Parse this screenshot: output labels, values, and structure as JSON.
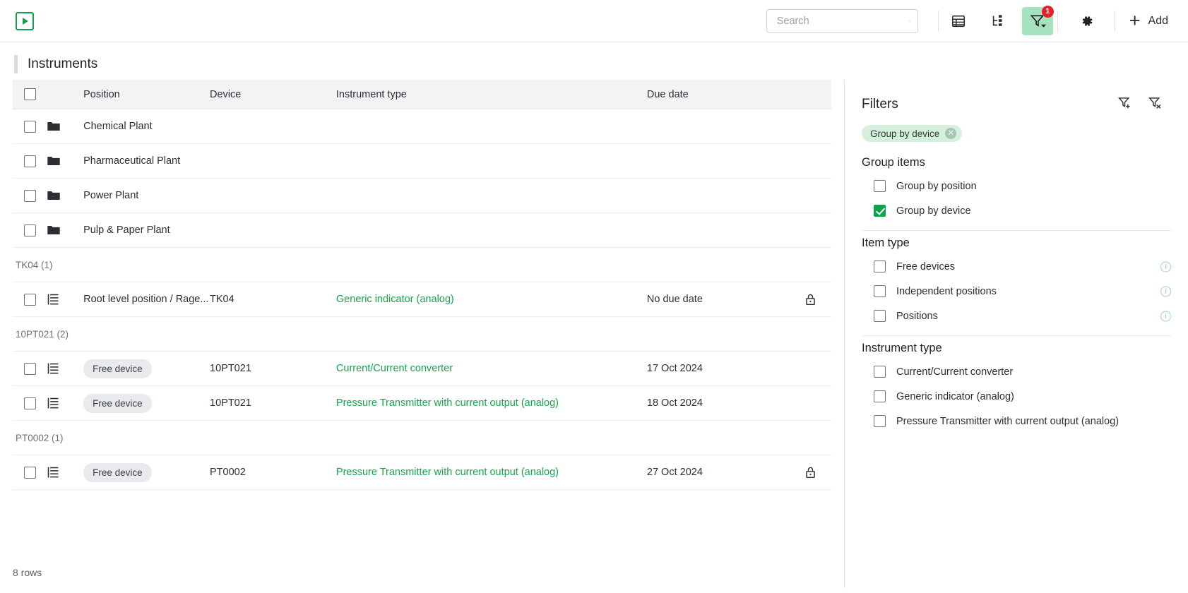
{
  "topbar": {
    "logo_icon": "play-square-logo",
    "search": {
      "value": "",
      "placeholder": "Search"
    },
    "search_icon": "search-icon",
    "tools": [
      {
        "name": "table-view-icon",
        "label": "",
        "active": false
      },
      {
        "name": "tree-view-icon",
        "label": "",
        "active": false
      },
      {
        "name": "filter-icon",
        "label": "",
        "active": true,
        "badge": "1"
      },
      {
        "name": "gear-icon",
        "label": "",
        "active": false
      }
    ],
    "add_label": "Add"
  },
  "page": {
    "title": "Instruments",
    "footer_rows": "8 rows"
  },
  "table": {
    "columns": [
      "Position",
      "Device",
      "Instrument type",
      "Due date"
    ],
    "rows": [
      {
        "kind": "folder",
        "icon": "folder-icon",
        "position": "Chemical Plant",
        "device": "",
        "type": "",
        "due": "",
        "locked": false,
        "badge": ""
      },
      {
        "kind": "folder",
        "icon": "folder-icon",
        "position": "Pharmaceutical Plant",
        "device": "",
        "type": "",
        "due": "",
        "locked": false,
        "badge": ""
      },
      {
        "kind": "folder",
        "icon": "folder-icon",
        "position": "Power Plant",
        "device": "",
        "type": "",
        "due": "",
        "locked": false,
        "badge": ""
      },
      {
        "kind": "folder",
        "icon": "folder-icon",
        "position": "Pulp & Paper Plant",
        "device": "",
        "type": "",
        "due": "",
        "locked": false,
        "badge": ""
      },
      {
        "kind": "group",
        "label": "TK04 (1)"
      },
      {
        "kind": "item",
        "icon": "instrument-stack-icon",
        "position": "Root level position / Rage...",
        "device": "TK04",
        "type": "Generic indicator (analog)",
        "due": "No due date",
        "locked": true,
        "badge": ""
      },
      {
        "kind": "group",
        "label": "10PT021 (2)"
      },
      {
        "kind": "item",
        "icon": "instrument-stack-icon",
        "position": "",
        "badge": "Free device",
        "device": "10PT021",
        "type": "Current/Current converter",
        "due": "17 Oct 2024",
        "locked": false
      },
      {
        "kind": "item",
        "icon": "instrument-stack-icon",
        "position": "",
        "badge": "Free device",
        "device": "10PT021",
        "type": "Pressure Transmitter with current output (analog)",
        "due": "18 Oct 2024",
        "locked": false
      },
      {
        "kind": "group",
        "label": "PT0002 (1)"
      },
      {
        "kind": "item",
        "icon": "instrument-stack-icon",
        "position": "",
        "badge": "Free device",
        "device": "PT0002",
        "type": "Pressure Transmitter with current output (analog)",
        "due": "27 Oct 2024",
        "locked": true
      }
    ]
  },
  "filters": {
    "title": "Filters",
    "head_icons": [
      {
        "name": "filter-add-icon"
      },
      {
        "name": "filter-clear-icon"
      }
    ],
    "chips": [
      {
        "label": "Group by device",
        "remove_icon": "chip-remove-icon"
      }
    ],
    "sections": [
      {
        "title": "Group items",
        "items": [
          {
            "label": "Group by position",
            "checked": false,
            "info": false
          },
          {
            "label": "Group by device",
            "checked": true,
            "info": false
          }
        ]
      },
      {
        "title": "Item type",
        "items": [
          {
            "label": "Free devices",
            "checked": false,
            "info": true
          },
          {
            "label": "Independent positions",
            "checked": false,
            "info": true
          },
          {
            "label": "Positions",
            "checked": false,
            "info": true
          }
        ]
      },
      {
        "title": "Instrument type",
        "items": [
          {
            "label": "Current/Current converter",
            "checked": false,
            "info": false
          },
          {
            "label": "Generic indicator (analog)",
            "checked": false,
            "info": false
          },
          {
            "label": "Pressure Transmitter with current output (analog)",
            "checked": false,
            "info": false
          }
        ]
      }
    ]
  },
  "colors": {
    "brand_green": "#10a14b",
    "link_green": "#16a34a",
    "active_bg": "#a6e2bd",
    "badge_red": "#e8202a",
    "chip_bg": "#d6f0df"
  }
}
